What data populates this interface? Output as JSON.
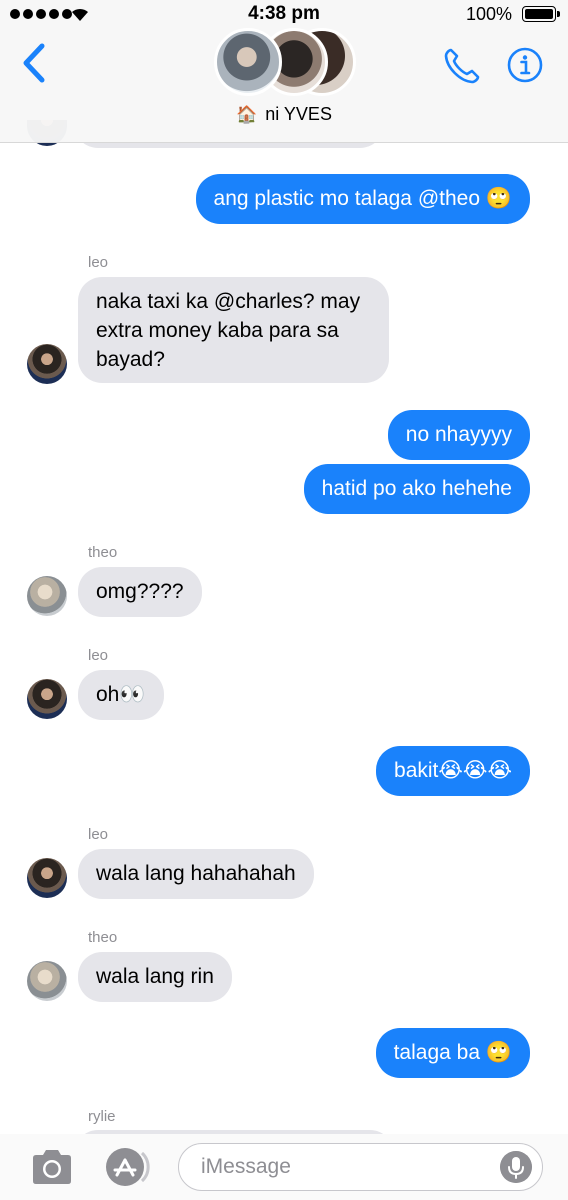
{
  "status_bar": {
    "time": "4:38 pm",
    "battery_percent": "100%"
  },
  "header": {
    "group_emoji": "🏠",
    "group_name": "ni YVES",
    "accent_color": "#1a82fb"
  },
  "messages": [
    {
      "id": "m1",
      "direction": "out",
      "text": "ang plastic mo talaga @theo 🙄"
    },
    {
      "id": "m2",
      "direction": "in",
      "sender": "leo",
      "lines": [
        "naka taxi ka @charles? may",
        "extra money kaba para sa",
        "bayad?"
      ]
    },
    {
      "id": "m3",
      "direction": "out",
      "text": "no nhayyyy"
    },
    {
      "id": "m4",
      "direction": "out",
      "text": "hatid po ako hehehe"
    },
    {
      "id": "m5",
      "direction": "in",
      "sender": "theo",
      "text": "omg????"
    },
    {
      "id": "m6",
      "direction": "in",
      "sender": "leo",
      "text": "oh👀"
    },
    {
      "id": "m7",
      "direction": "out",
      "text": "bakit😭😭😭"
    },
    {
      "id": "m8",
      "direction": "in",
      "sender": "leo",
      "text": "wala lang hahahahah"
    },
    {
      "id": "m9",
      "direction": "in",
      "sender": "theo",
      "text": "wala lang rin"
    },
    {
      "id": "m10",
      "direction": "out",
      "text": "talaga ba 🙄"
    },
    {
      "id": "m11",
      "direction": "in",
      "sender": "rylie",
      "text": ""
    }
  ],
  "input": {
    "placeholder": "iMessage",
    "value": ""
  },
  "icons": {
    "back": "chevron-left-icon",
    "phone": "phone-icon",
    "info": "info-icon",
    "camera": "camera-icon",
    "apps": "app-store-icon",
    "mic": "microphone-icon"
  }
}
